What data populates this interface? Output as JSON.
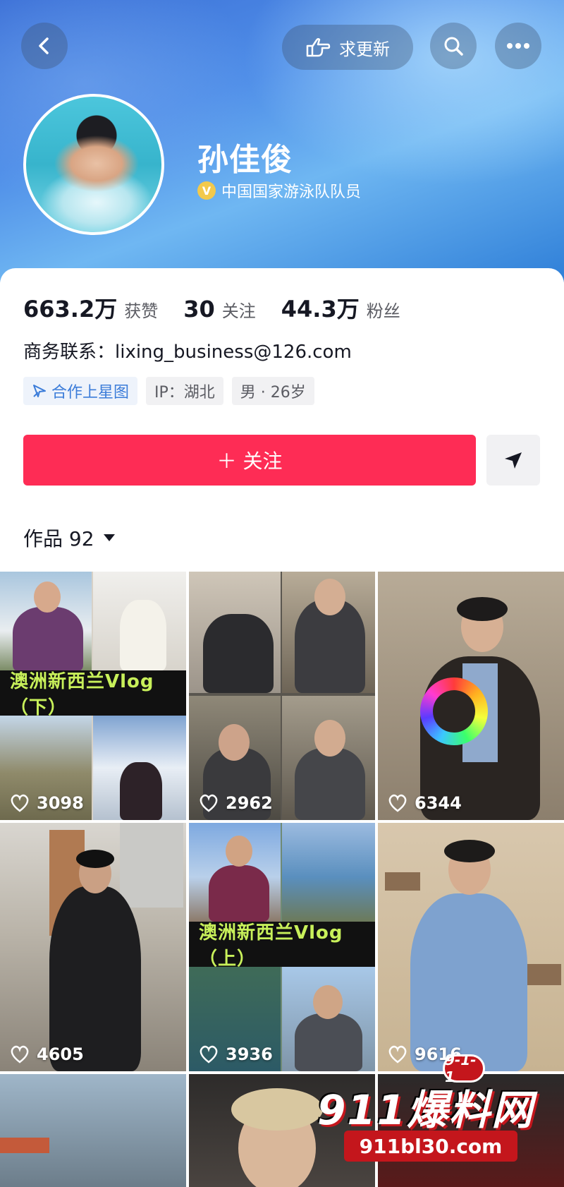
{
  "header": {
    "update_label": "求更新",
    "icons": [
      "back-arrow-icon",
      "point-hand-icon",
      "search-icon",
      "more-dots-icon"
    ]
  },
  "profile": {
    "name": "孙佳俊",
    "verified_badge": "V",
    "verified_text": "中国国家游泳队队员"
  },
  "stats": [
    {
      "value": "663.2万",
      "label": "获赞"
    },
    {
      "value": "30",
      "label": "关注"
    },
    {
      "value": "44.3万",
      "label": "粉丝"
    }
  ],
  "contact": "商务联系：lixing_business@126.com",
  "tags": [
    {
      "label": "合作上星图",
      "icon": "star-map-icon"
    },
    {
      "label": "IP：湖北"
    },
    {
      "label": "男 · 26岁"
    }
  ],
  "follow_label": "＋ 关注",
  "works": {
    "label": "作品 92"
  },
  "videos": [
    {
      "likes": "3098",
      "banner": "澳洲新西兰Vlog（下）"
    },
    {
      "likes": "2962"
    },
    {
      "likes": "6344"
    },
    {
      "likes": "4605"
    },
    {
      "likes": "3936",
      "banner": "澳洲新西兰Vlog（上）"
    },
    {
      "likes": "9616"
    },
    {},
    {},
    {}
  ],
  "watermark": {
    "badge": "9-1-1",
    "title": "911爆料网",
    "url": "911bl30.com"
  },
  "colors": {
    "accent": "#fe2c55",
    "header_blue": "#3b6fd6"
  }
}
